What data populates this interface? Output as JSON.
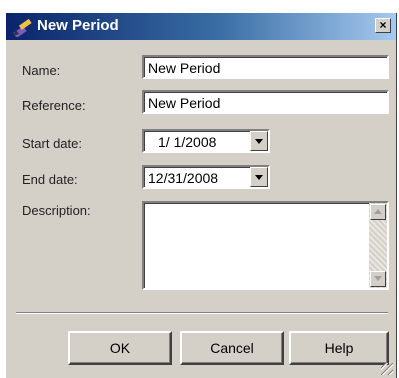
{
  "dialog": {
    "title": "New Period",
    "close_label": "×"
  },
  "form": {
    "name_label": "Name:",
    "name_value": "New Period",
    "reference_label": "Reference:",
    "reference_value": "New Period",
    "start_label": "Start date:",
    "start_value": "1/ 1/2008",
    "end_label": "End date:",
    "end_value": "12/31/2008",
    "description_label": "Description:",
    "description_value": ""
  },
  "buttons": {
    "ok": "OK",
    "cancel": "Cancel",
    "help": "Help"
  },
  "colors": {
    "title_bar_start": "#0a246a",
    "title_bar_end": "#a6caf0",
    "dialog_background": "#d4d0c8"
  },
  "icons": {
    "title": "edit-pencil-icon",
    "close": "close-icon",
    "dropdown": "chevron-down-icon"
  }
}
